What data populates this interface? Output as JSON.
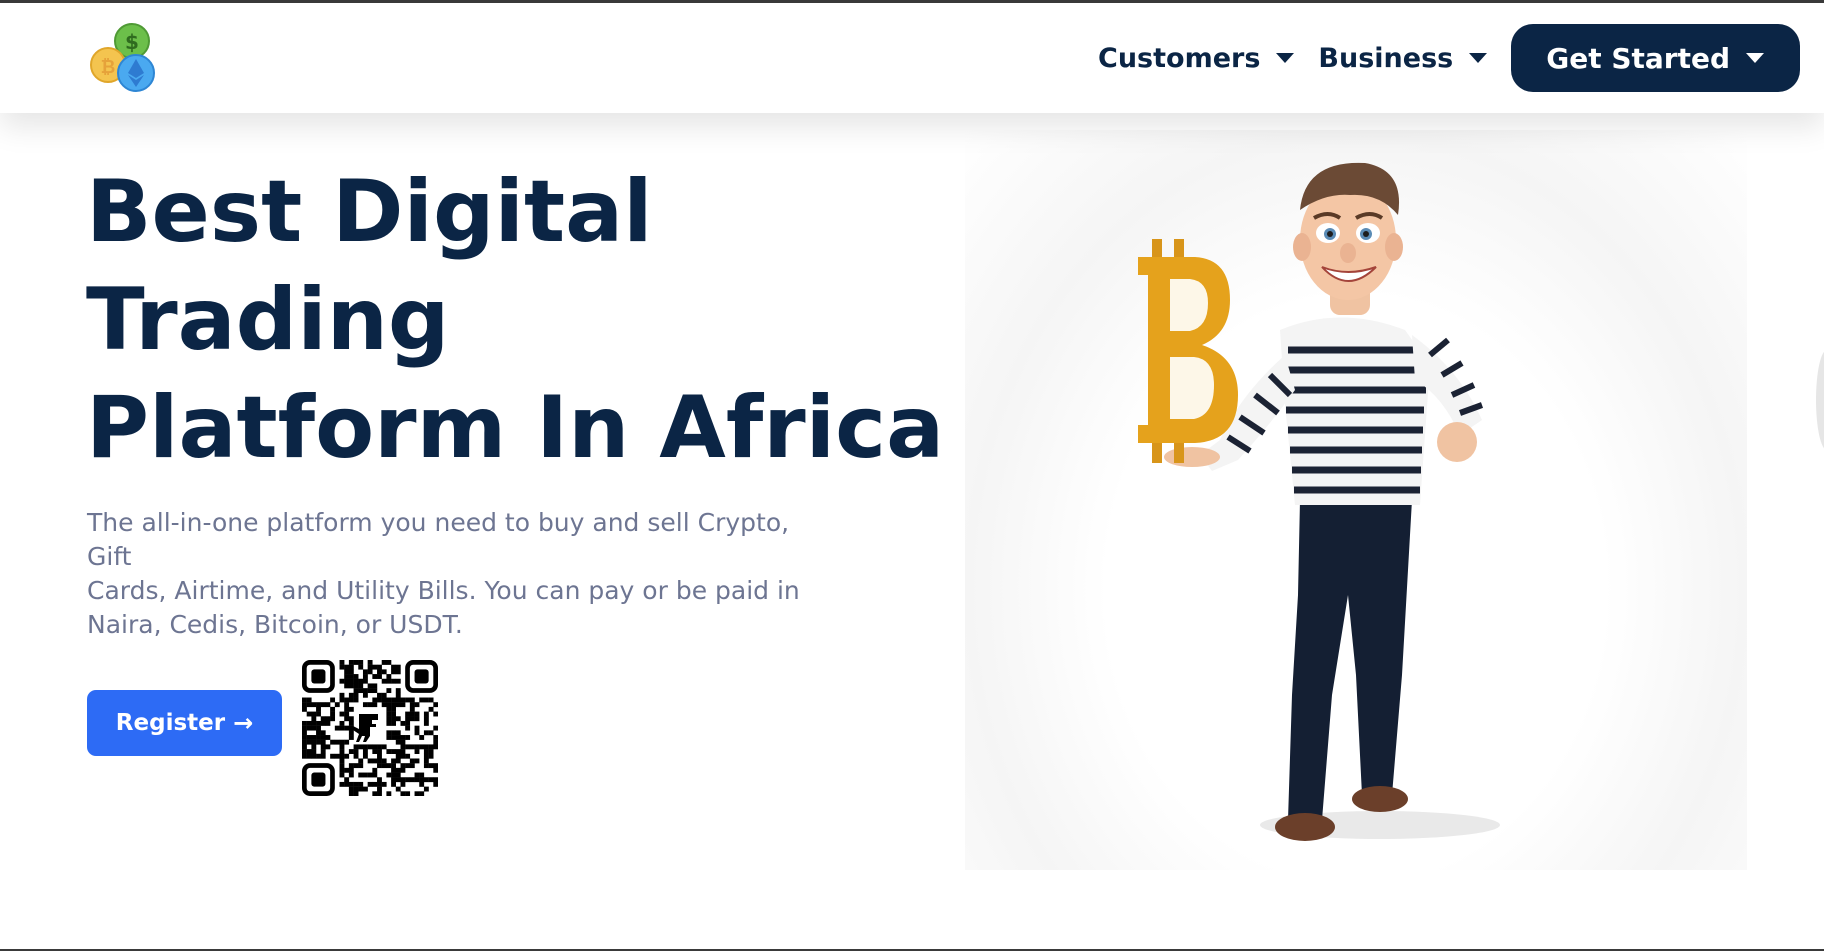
{
  "header": {
    "logo_icon": "coins-logo-icon",
    "nav": [
      {
        "label": "Customers",
        "icon": "caret-down-icon"
      },
      {
        "label": "Business",
        "icon": "caret-down-icon"
      }
    ],
    "cta_label": "Get Started"
  },
  "hero": {
    "title_lines": [
      "Best Digital",
      "Trading",
      "Platform In Africa"
    ],
    "subtitle_lines": [
      "The all-in-one platform you need to buy and sell Crypto, Gift",
      "Cards, Airtime, and Utility Bills. You can pay or be paid in",
      "Naira, Cedis, Bitcoin, or USDT."
    ],
    "register_label": "Register",
    "register_icon": "arrow-right-icon",
    "qr_icon": "qr-code-icon",
    "illustration": "character-holding-bitcoin-illustration"
  },
  "colors": {
    "navy": "#0b2545",
    "button_blue": "#2d6bf5",
    "subtitle_gray": "#6d7592",
    "bitcoin_gold": "#e5a21c"
  }
}
